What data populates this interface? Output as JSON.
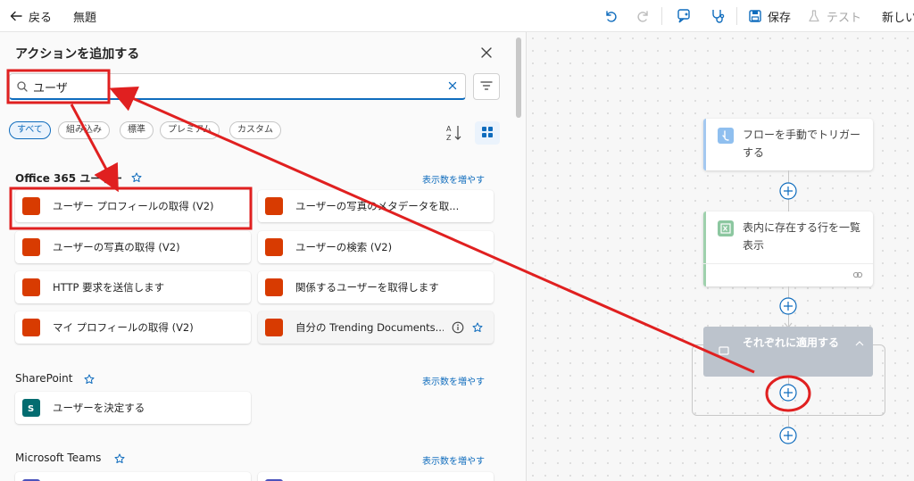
{
  "topbar": {
    "back_label": "戻る",
    "flow_name": "無題",
    "save_label": "保存",
    "test_label": "テスト",
    "new_label": "新しい"
  },
  "panel": {
    "title": "アクションを追加する",
    "search": {
      "value": "ユーザ",
      "placeholder": ""
    },
    "chips": [
      "すべて",
      "組み込み",
      "標準",
      "プレミアム",
      "カスタム"
    ],
    "active_chip": "すべて",
    "sort_label": "A Z",
    "sections": [
      {
        "title": "Office 365 ユーザー",
        "show_more": "表示数を増やす",
        "actions": [
          {
            "label": "ユーザー プロフィールの取得 (V2)"
          },
          {
            "label": "ユーザーの写真のメタデータを取..."
          },
          {
            "label": "ユーザーの写真の取得 (V2)"
          },
          {
            "label": "ユーザーの検索 (V2)"
          },
          {
            "label": "HTTP 要求を送信します"
          },
          {
            "label": "関係するユーザーを取得します"
          },
          {
            "label": "マイ プロフィールの取得 (V2)"
          },
          {
            "label": "自分の Trending Documents..."
          }
        ]
      },
      {
        "title": "SharePoint",
        "show_more": "表示数を増やす",
        "actions": [
          {
            "label": "ユーザーを決定する"
          }
        ]
      },
      {
        "title": "Microsoft Teams",
        "show_more": "表示数を増やす",
        "actions": []
      }
    ]
  },
  "canvas": {
    "nodes": {
      "trigger": "フローを手動でトリガーする",
      "excel": "表内に存在する行を一覧表示",
      "loop": "それぞれに適用する"
    }
  },
  "colors": {
    "accent": "#0f6cbd",
    "office365": "#d83b01",
    "sharepoint": "#036c70",
    "teams": "#4b53bc",
    "annotation": "#e02020"
  }
}
